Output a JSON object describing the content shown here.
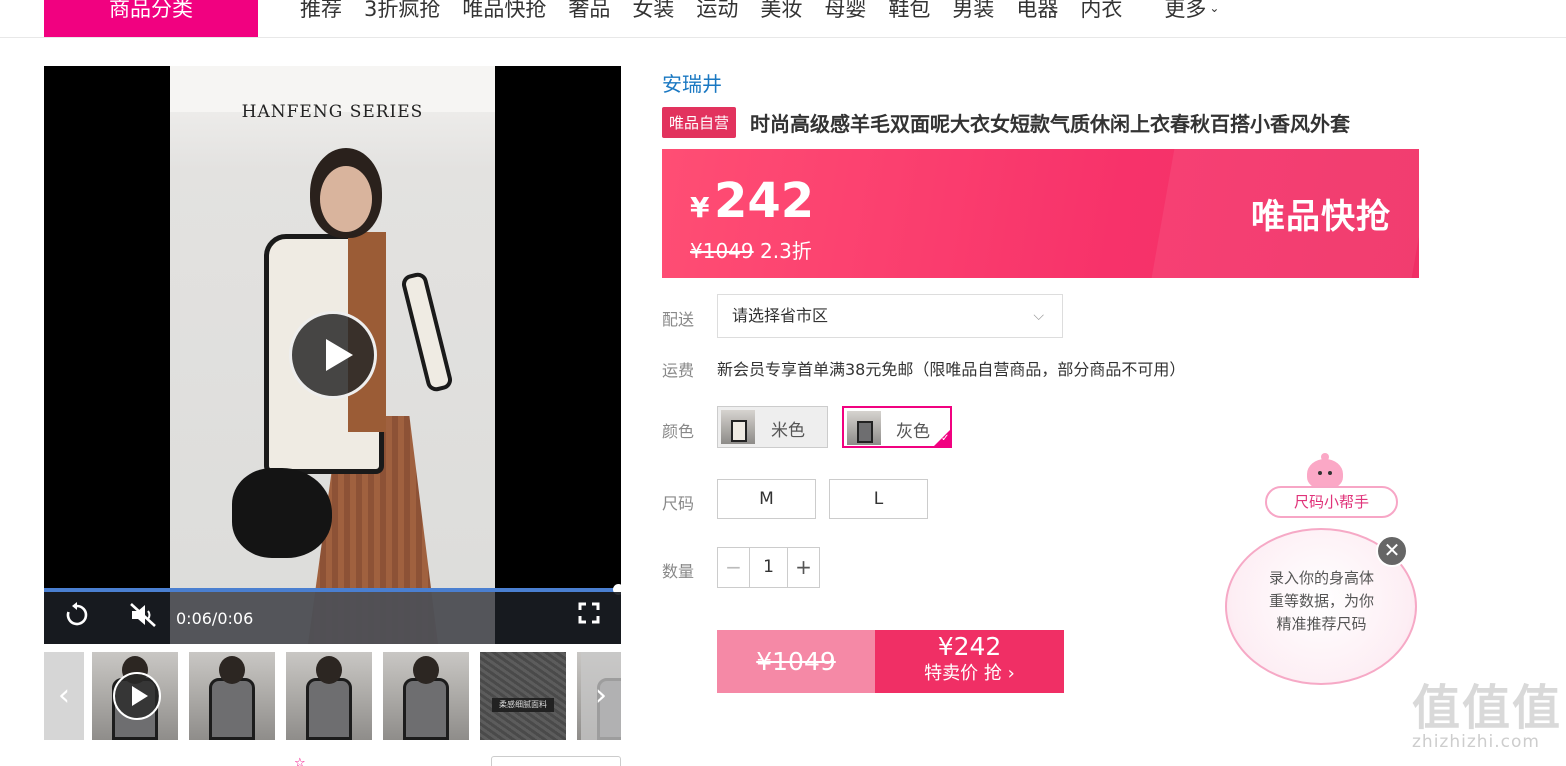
{
  "nav": {
    "category_button": "商品分类",
    "links": [
      "推荐",
      "3折疯抢",
      "唯品快抢",
      "奢品",
      "女装",
      "运动",
      "美妆",
      "母婴",
      "鞋包",
      "男装",
      "电器",
      "内衣"
    ],
    "more": "更多"
  },
  "video": {
    "series_text": "HANFENG SERIES",
    "time": "0:06/0:06",
    "progress": 1.0,
    "icons": {
      "replay": "replay-icon",
      "mute": "volume-muted-icon",
      "fullscreen": "fullscreen-icon",
      "play": "play-icon"
    }
  },
  "thumbnails": {
    "fabric_label": "柔感细腻面料",
    "prev_icon": "chevron-left-icon",
    "next_icon": "chevron-right-icon"
  },
  "product": {
    "brand": "安瑞井",
    "badge": "唯品自营",
    "title": "时尚高级感羊毛双面呢大衣女短款气质休闲上衣春秋百搭小香风外套",
    "price_symbol": "¥",
    "price": "242",
    "original_price": "¥1049",
    "discount": "2.3折",
    "promo_label": "唯品快抢"
  },
  "delivery": {
    "label": "配送",
    "placeholder": "请选择省市区"
  },
  "shipping": {
    "label": "运费",
    "text": "新会员专享首单满38元免邮（限唯品自营商品，部分商品不可用）"
  },
  "color": {
    "label": "颜色",
    "options": [
      "米色",
      "灰色"
    ],
    "selected": "灰色"
  },
  "size": {
    "label": "尺码",
    "options": [
      "M",
      "L"
    ]
  },
  "quantity": {
    "label": "数量",
    "minus": "−",
    "plus": "+",
    "value": "1"
  },
  "buy_button": {
    "original_price": "¥1049",
    "price": "¥242",
    "text": "特卖价 抢 ›"
  },
  "size_helper": {
    "tag": "尺码小帮手",
    "lines": [
      "录入你的身高体",
      "重等数据，为你",
      "精准推荐尺码"
    ],
    "close": "✕"
  },
  "watermark": {
    "big": "值值值",
    "small": "zhizhizhi.com"
  },
  "colors": {
    "accent": "#f10180",
    "price_bg": "#f7326a",
    "brand_link": "#1a78c2"
  }
}
